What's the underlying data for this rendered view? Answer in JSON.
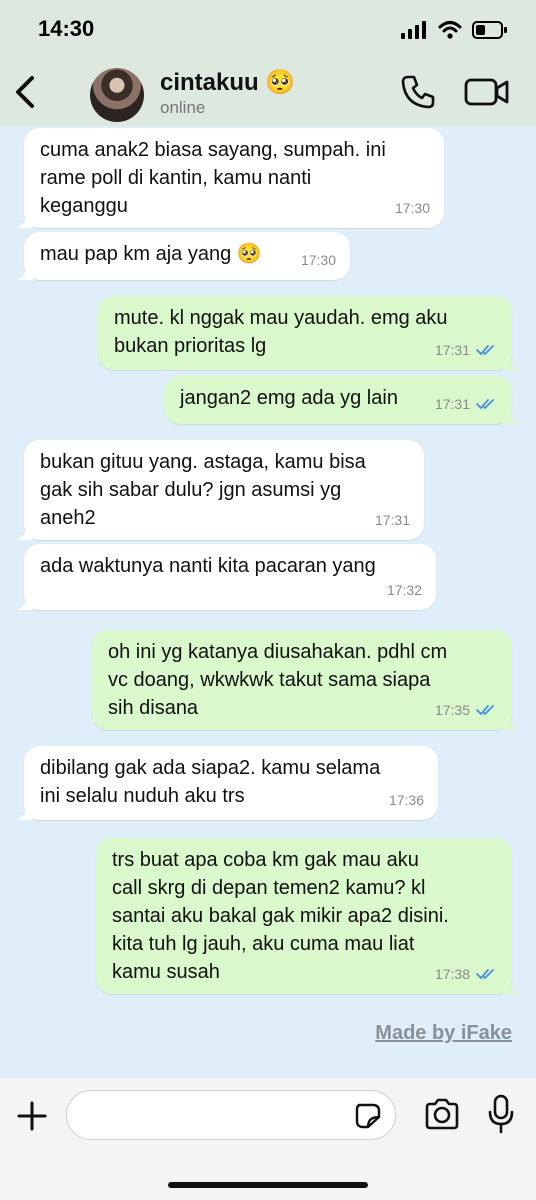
{
  "status_bar": {
    "time": "14:30"
  },
  "header": {
    "contact_name": "cintakuu 🥺",
    "status": "online"
  },
  "messages": [
    {
      "dir": "in",
      "text": "cuma anak2 biasa sayang, sumpah. ini\nrame poll di kantin, kamu nanti\nkeganggu",
      "time": "17:30"
    },
    {
      "dir": "in",
      "text": "mau pap km aja yang 🥺",
      "time": "17:30"
    },
    {
      "dir": "out",
      "text": "mute. kl nggak mau yaudah. emg aku\nbukan prioritas lg",
      "time": "17:31"
    },
    {
      "dir": "out",
      "text": "jangan2 emg ada yg lain",
      "time": "17:31"
    },
    {
      "dir": "in",
      "text": "bukan gituu yang. astaga, kamu bisa\ngak sih sabar dulu? jgn asumsi yg\naneh2",
      "time": "17:31"
    },
    {
      "dir": "in",
      "text": "ada waktunya nanti kita pacaran yang",
      "time": "17:32"
    },
    {
      "dir": "out",
      "text": "oh ini yg katanya diusahakan. pdhl cm\nvc doang, wkwkwk takut sama siapa\nsih disana",
      "time": "17:35"
    },
    {
      "dir": "in",
      "text": "dibilang gak ada siapa2. kamu selama\nini selalu nuduh aku trs",
      "time": "17:36"
    },
    {
      "dir": "out",
      "text": "trs buat apa coba km gak mau aku\ncall skrg di depan temen2 kamu? kl\nsantai aku bakal gak mikir apa2 disini.\nkita tuh lg jauh, aku cuma mau liat\nkamu susah",
      "time": "17:38"
    }
  ],
  "watermark": "Made by iFake",
  "colors": {
    "incoming_bubble": "#ffffff",
    "outgoing_bubble": "#d9f9cc",
    "chat_background": "#dfeef9",
    "read_ticks": "#4a8fe0"
  },
  "icons": [
    "back-chevron",
    "phone",
    "video-camera",
    "plus",
    "sticker",
    "camera",
    "microphone"
  ]
}
